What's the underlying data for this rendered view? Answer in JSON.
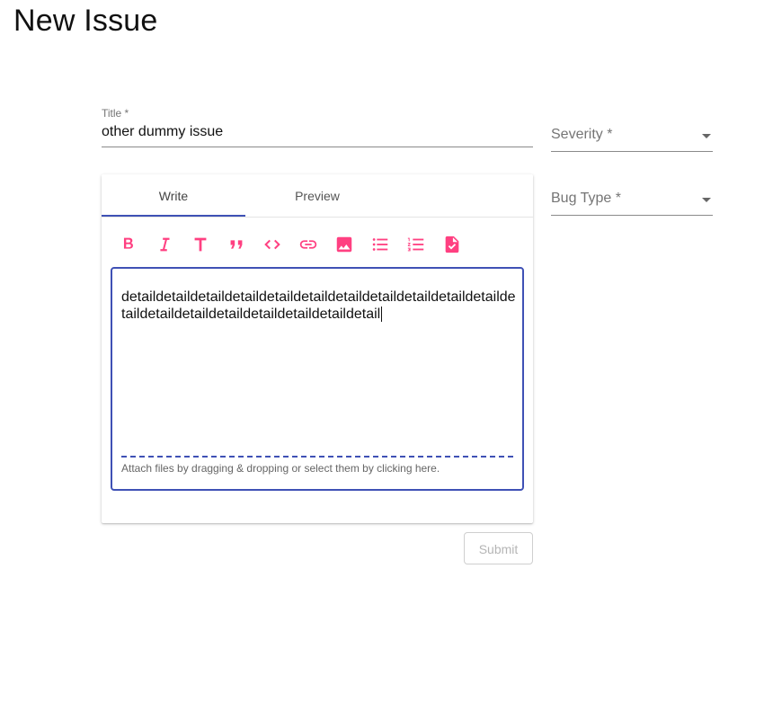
{
  "page": {
    "title": "New Issue"
  },
  "form": {
    "title_label": "Title *",
    "title_value": "other dummy issue",
    "severity_placeholder": "Severity *",
    "bug_type_placeholder": "Bug Type *",
    "submit_label": "Submit"
  },
  "editor": {
    "tabs": [
      {
        "label": "Write",
        "active": true
      },
      {
        "label": "Preview",
        "active": false
      }
    ],
    "toolbar": [
      {
        "icon": "bold-icon"
      },
      {
        "icon": "italic-icon"
      },
      {
        "icon": "header-icon"
      },
      {
        "icon": "quote-icon"
      },
      {
        "icon": "code-icon"
      },
      {
        "icon": "link-icon"
      },
      {
        "icon": "image-icon"
      },
      {
        "icon": "unordered-list-icon"
      },
      {
        "icon": "ordered-list-icon"
      },
      {
        "icon": "checked-list-icon"
      }
    ],
    "content": "detaildetaildetaildetaildetaildetaildetaildetaildetaildetaildetaildetaildetaildetaildetaildetaildetaildetaildetail",
    "attach_hint": "Attach files by dragging & dropping or select them by clicking here."
  },
  "colors": {
    "accent": "#3f51b5",
    "icon": "#ff4081",
    "muted_text": "#757575"
  }
}
